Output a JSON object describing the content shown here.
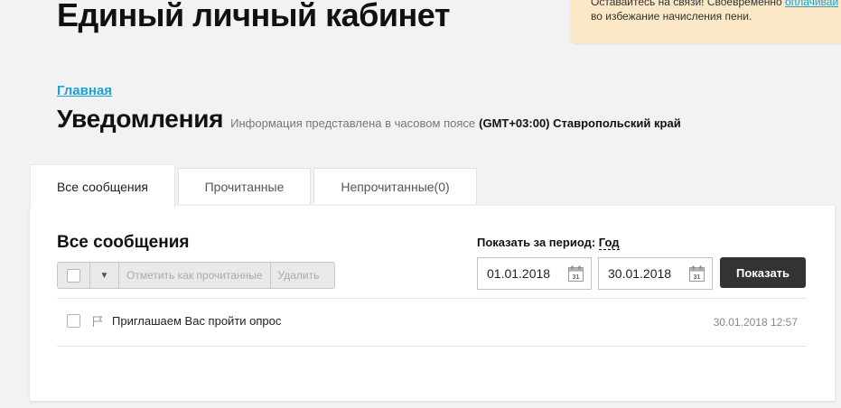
{
  "header": {
    "title": "Единый личный кабинет"
  },
  "notice": {
    "line1_prefix": "Оставайтесь на связи! Своевременно ",
    "line1_link": "оплачивай",
    "line2": "во избежание начисления пени."
  },
  "breadcrumb": {
    "home": "Главная"
  },
  "section": {
    "title": "Уведомления",
    "tz_info": "Информация представлена в часовом поясе",
    "tz_value": "(GMT+03:00) Ставропольский край"
  },
  "tabs": [
    {
      "label": "Все сообщения",
      "active": true
    },
    {
      "label": "Прочитанные",
      "active": false
    },
    {
      "label": "Непрочитанные(0)",
      "active": false
    }
  ],
  "panel": {
    "title": "Все сообщения",
    "toolbar": {
      "mark_read": "Отметить как прочитанные",
      "delete": "Удалить"
    },
    "period": {
      "label": "Показать за период:",
      "value": "Год",
      "date_from": "01.01.2018",
      "date_to": "30.01.2018",
      "calendar_day": "31",
      "show_button": "Показать"
    },
    "messages": [
      {
        "text": "Приглашаем Вас пройти опрос",
        "date": "30.01.2018 12:57"
      }
    ]
  },
  "icons": {
    "caret": "chevron-down-icon",
    "calendar": "calendar-icon",
    "flag": "flag-icon"
  },
  "colors": {
    "link": "#1aa3d9",
    "notice_bg": "#fbe8c6",
    "primary_button": "#333333"
  }
}
